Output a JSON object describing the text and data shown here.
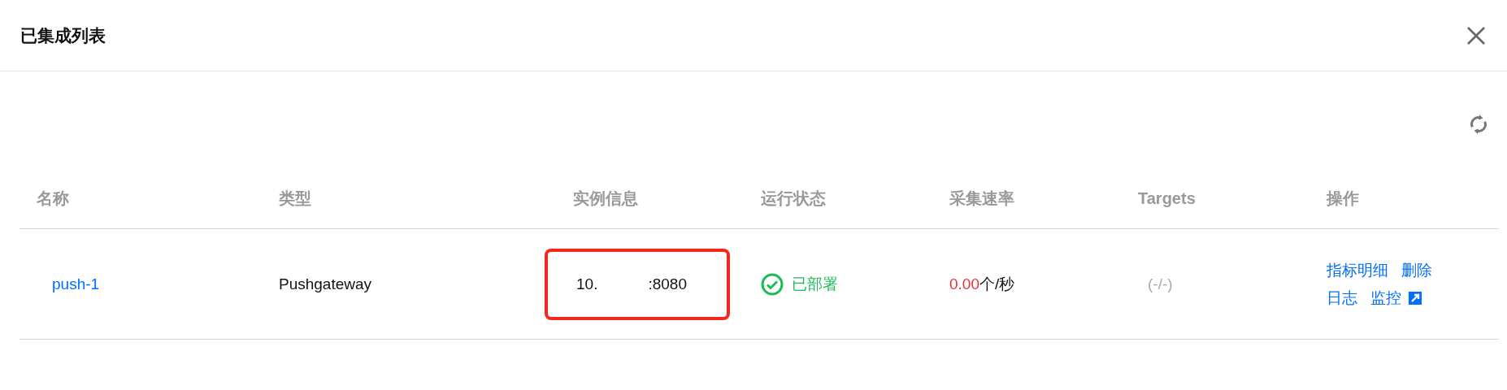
{
  "window": {
    "title": "已集成列表"
  },
  "table": {
    "columns": [
      "名称",
      "类型",
      "实例信息",
      "运行状态",
      "采集速率",
      "Targets",
      "操作"
    ],
    "rows": [
      {
        "name": "push-1",
        "type": "Pushgateway",
        "instance": {
          "prefix": "10.",
          "suffix": ":8080",
          "highlighted": true
        },
        "status": {
          "kind": "deployed",
          "label": "已部署"
        },
        "rate": {
          "value": "0.00",
          "unit": "个/秒"
        },
        "targets": "(-/-)",
        "actions": [
          [
            {
              "label": "指标明细",
              "external": false
            },
            {
              "label": "删除",
              "external": false
            }
          ],
          [
            {
              "label": "日志",
              "external": false
            },
            {
              "label": "监控",
              "external": true
            }
          ]
        ]
      }
    ]
  }
}
